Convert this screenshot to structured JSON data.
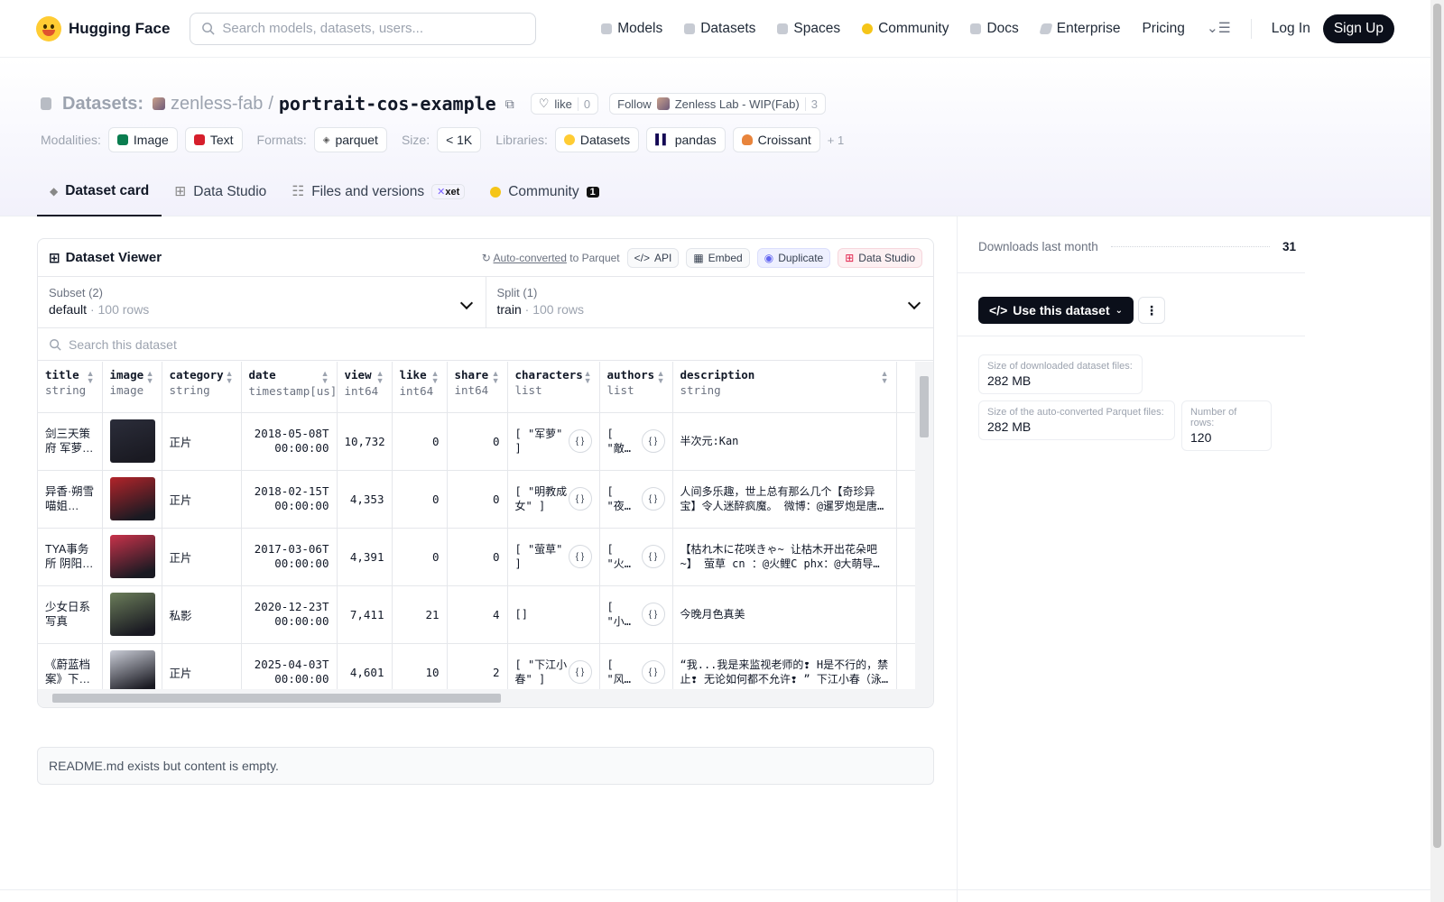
{
  "header": {
    "brand": "Hugging Face",
    "search_placeholder": "Search models, datasets, users...",
    "nav": [
      {
        "label": "Models"
      },
      {
        "label": "Datasets"
      },
      {
        "label": "Spaces"
      },
      {
        "label": "Community"
      },
      {
        "label": "Docs"
      },
      {
        "label": "Enterprise"
      },
      {
        "label": "Pricing"
      }
    ],
    "login": "Log In",
    "signup": "Sign Up"
  },
  "repo": {
    "type_label": "Datasets:",
    "owner": "zenless-fab",
    "sep": "/",
    "name": "portrait-cos-example",
    "like_label": "like",
    "like_count": "0",
    "follow_label": "Follow",
    "org_name": "Zenless Lab - WIP(Fab)",
    "follow_count": "3"
  },
  "meta": {
    "modalities_label": "Modalities:",
    "modalities": [
      "Image",
      "Text"
    ],
    "formats_label": "Formats:",
    "format": "parquet",
    "size_label": "Size:",
    "size": "< 1K",
    "libraries_label": "Libraries:",
    "libraries": [
      "Datasets",
      "pandas",
      "Croissant"
    ],
    "more": "+ 1"
  },
  "tabs": {
    "card": "Dataset card",
    "studio": "Data Studio",
    "files": "Files and versions",
    "xet": "xet",
    "community": "Community",
    "community_count": "1"
  },
  "viewer": {
    "title": "Dataset Viewer",
    "auto_converted": "Auto-converted",
    "to_parquet": "to Parquet",
    "api": "API",
    "embed": "Embed",
    "duplicate": "Duplicate",
    "data_studio": "Data Studio",
    "subset_label": "Subset (2)",
    "subset_value": "default",
    "subset_rows": "100 rows",
    "split_label": "Split (1)",
    "split_value": "train",
    "split_rows": "100 rows",
    "search_placeholder": "Search this dataset",
    "columns": [
      {
        "name": "title",
        "type": "string"
      },
      {
        "name": "image",
        "type": "image"
      },
      {
        "name": "category",
        "type": "string"
      },
      {
        "name": "date",
        "type": "timestamp[us]"
      },
      {
        "name": "view",
        "type": "int64"
      },
      {
        "name": "like",
        "type": "int64"
      },
      {
        "name": "share",
        "type": "int64"
      },
      {
        "name": "characters",
        "type": "list"
      },
      {
        "name": "authors",
        "type": "list"
      },
      {
        "name": "description",
        "type": "string"
      }
    ],
    "rows": [
      {
        "title": "剑三天策府 军萝…",
        "category": "正片",
        "date": "2018-05-08T00:00:00",
        "view": "10,732",
        "like": "0",
        "share": "0",
        "characters": "[ \"军萝\" ]",
        "authors": "[ \"敵…",
        "description": "半次元:Kan",
        "color": "#2b2d3a"
      },
      {
        "title": "异香·朔雪喵姐…",
        "category": "正片",
        "date": "2018-02-15T00:00:00",
        "view": "4,353",
        "like": "0",
        "share": "0",
        "characters": "[ \"明教成女\" ]",
        "authors": "[ \"夜…",
        "description": "人间多乐趣，世上总有那么几个【奇珍异宝】令人迷醉疯魔。 微博：@暹罗炮是唐…",
        "color": "#b3242a"
      },
      {
        "title": "TYA事务所 阴阳…",
        "category": "正片",
        "date": "2017-03-06T00:00:00",
        "view": "4,391",
        "like": "0",
        "share": "0",
        "characters": "[ \"萤草\" ]",
        "authors": "[ \"火…",
        "description": "【枯れ木に花咲きゃ~ 让枯木开出花朵吧~】 萤草 cn ：@火鲤C phx：@大萌导师…",
        "color": "#c8324a"
      },
      {
        "title": "少女日系写真",
        "category": "私影",
        "date": "2020-12-23T00:00:00",
        "view": "7,411",
        "like": "21",
        "share": "4",
        "characters": "[]",
        "authors": "[ \"小…",
        "description": "今晚月色真美",
        "color": "#6b7d5a"
      },
      {
        "title": "《蔚蓝档案》下江…",
        "category": "正片",
        "date": "2025-04-03T00:00:00",
        "view": "4,601",
        "like": "10",
        "share": "2",
        "characters": "[ \"下江小春\" ]",
        "authors": "[ \"风…",
        "description": "“我...我是来监视老师的❢ H是不行的，禁止❢ 无论如何都不允许❢ ” 下江小春（泳…",
        "color": "#c9ccd6"
      }
    ]
  },
  "readme": "README.md exists but content is empty.",
  "sidebar": {
    "downloads_label": "Downloads last month",
    "downloads": "31",
    "use_label": "Use this dataset",
    "dl_size_label": "Size of downloaded dataset files:",
    "dl_size": "282 MB",
    "pq_size_label": "Size of the auto-converted Parquet files:",
    "pq_size": "282 MB",
    "rows_label": "Number of rows:",
    "rows": "120"
  }
}
